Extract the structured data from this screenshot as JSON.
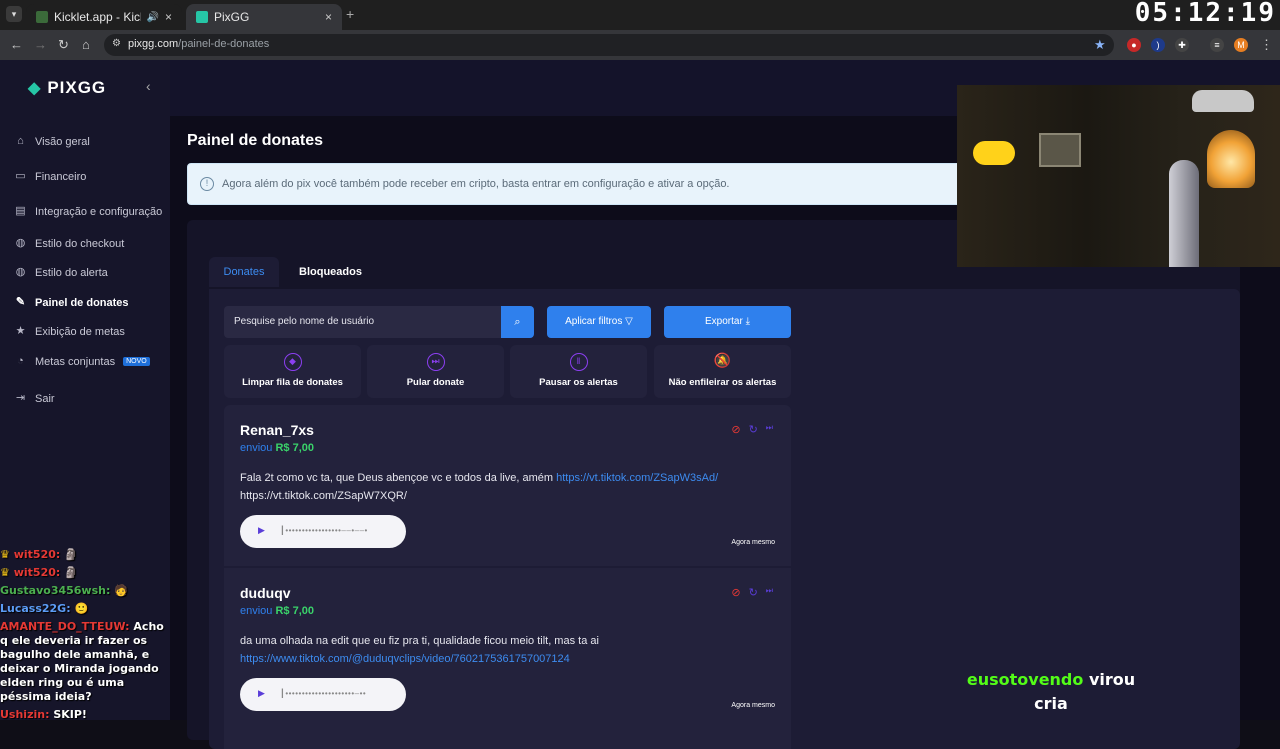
{
  "browser": {
    "tabs": [
      {
        "title": "Kicklet.app - Kick Chatbot e",
        "favicon_color": "#3b6a3a"
      },
      {
        "title": "PixGG",
        "favicon_color": "#26c6a6"
      }
    ],
    "new_tab": "+",
    "close": "×",
    "url_host": "pixgg.com",
    "url_path": "/painel-de-donates",
    "profile_initial": "M"
  },
  "clock": "05:12:19",
  "sidebar": {
    "logo": "PIXGG",
    "items": [
      {
        "label": "Visão geral",
        "icon": "home-icon"
      },
      {
        "label": "Financeiro",
        "icon": "wallet-icon"
      },
      {
        "label": "Integração e configuração",
        "icon": "integration-icon"
      },
      {
        "label": "Estilo do checkout",
        "icon": "palette-icon"
      },
      {
        "label": "Estilo do alerta",
        "icon": "palette-icon"
      },
      {
        "label": "Painel de donates",
        "icon": "donates-icon"
      },
      {
        "label": "Exibição de metas",
        "icon": "star-icon"
      },
      {
        "label": "Metas conjuntas",
        "icon": "goals-icon",
        "badge": "NOVO"
      },
      {
        "label": "Sair",
        "icon": "logout-icon"
      }
    ]
  },
  "chat": [
    {
      "user": "wit520:",
      "color": "#e53935",
      "crown": true,
      "text": "🗿"
    },
    {
      "user": "wit520:",
      "color": "#e53935",
      "crown": true,
      "text": "🗿"
    },
    {
      "user": "Gustavo3456wsh:",
      "color": "#4caf50",
      "crown": false,
      "text": "🧑"
    },
    {
      "user": "Lucass22G:",
      "color": "#5c9cf5",
      "crown": false,
      "text": "🙂"
    },
    {
      "user": "AMANTE_DO_TTEUW:",
      "color": "#e53935",
      "crown": false,
      "text": "Acho q ele deveria ir fazer os bagulho dele amanhã, e deixar o Miranda jogando elden ring ou é uma péssima ideia?"
    },
    {
      "user": "Ushizin:",
      "color": "#e53935",
      "crown": false,
      "text": "SKIP!"
    }
  ],
  "page": {
    "title": "Painel de donates",
    "info": "Agora além do pix você também pode receber em cripto, basta entrar em configuração e ativar a opção.",
    "tabs": [
      "Donates",
      "Bloqueados"
    ],
    "search_placeholder": "Pesquise pelo nome de usuário",
    "filter_label": "Aplicar filtros",
    "export_label": "Exportar",
    "actions": [
      "Limpar fila de donates",
      "Pular donate",
      "Pausar os alertas",
      "Não enfileirar os alertas"
    ],
    "donations": [
      {
        "name": "Renan_7xs",
        "sent_word": "enviou",
        "amount": "R$ 7,00",
        "message": "Fala 2t como vc ta, que Deus abençoe vc e todos da live, amém ",
        "link": "https://vt.tiktok.com/ZSapW3sAd/",
        "message_tail": "https://vt.tiktok.com/ZSapW7XQR/",
        "time": "Agora mesmo"
      },
      {
        "name": "duduqv",
        "sent_word": "enviou",
        "amount": "R$ 7,00",
        "message": "da uma olhada na edit que eu fiz pra ti, qualidade ficou meio tilt, mas ta ai",
        "link": "https://www.tiktok.com/@duduqvclips/video/7602175361757007124",
        "message_tail": "",
        "time": "Agora mesmo"
      }
    ]
  },
  "overlay": {
    "user": "eusotovendo",
    "text": "virou cria"
  }
}
